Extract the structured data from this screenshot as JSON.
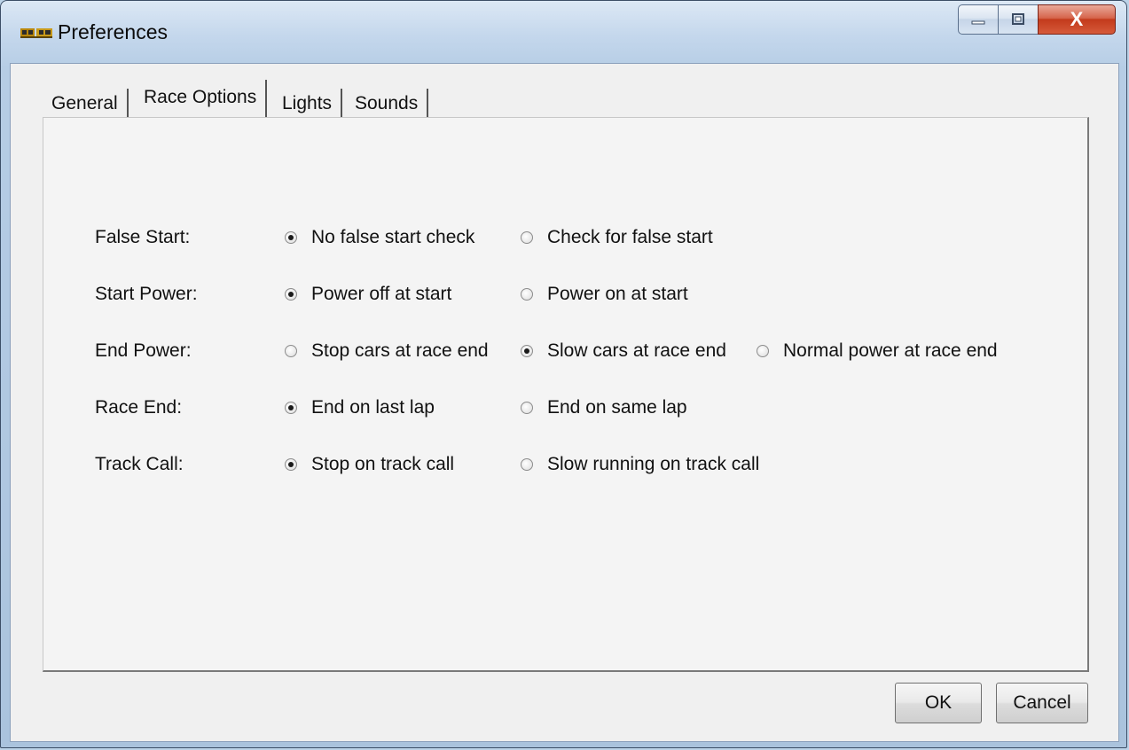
{
  "window": {
    "title": "Preferences",
    "app_icon": "race-car-icon",
    "caption": {
      "minimize_icon": "minimize-icon",
      "maximize_icon": "maximize-icon",
      "close_glyph": "X"
    }
  },
  "tabs": [
    {
      "label": "General",
      "selected": false
    },
    {
      "label": "Race Options",
      "selected": true
    },
    {
      "label": "Lights",
      "selected": false
    },
    {
      "label": "Sounds",
      "selected": false
    }
  ],
  "settings": [
    {
      "label": "False Start:",
      "options": [
        {
          "label": "No false start check",
          "checked": true
        },
        {
          "label": "Check for false start",
          "checked": false
        }
      ]
    },
    {
      "label": "Start Power:",
      "options": [
        {
          "label": "Power off at start",
          "checked": true
        },
        {
          "label": "Power on at start",
          "checked": false
        }
      ]
    },
    {
      "label": "End Power:",
      "options": [
        {
          "label": "Stop cars at race end",
          "checked": false
        },
        {
          "label": "Slow cars at race end",
          "checked": true
        },
        {
          "label": "Normal power at race end",
          "checked": false
        }
      ]
    },
    {
      "label": "Race End:",
      "options": [
        {
          "label": "End on last lap",
          "checked": true
        },
        {
          "label": "End on same lap",
          "checked": false
        }
      ]
    },
    {
      "label": "Track Call:",
      "options": [
        {
          "label": "Stop on track call",
          "checked": true
        },
        {
          "label": "Slow running on track call",
          "checked": false
        }
      ]
    }
  ],
  "buttons": {
    "ok": "OK",
    "cancel": "Cancel"
  }
}
